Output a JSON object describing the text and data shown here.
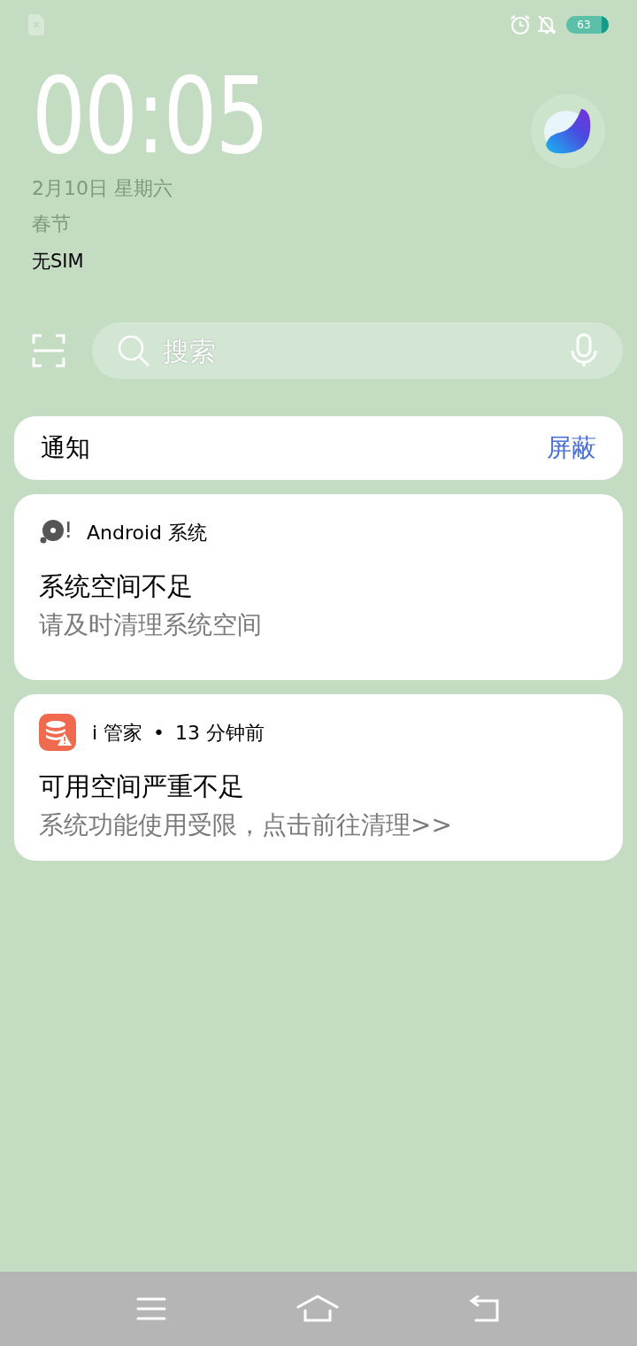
{
  "status_bar": {
    "battery_text": "63"
  },
  "clock": {
    "time": "00:05",
    "date": "2月10日 星期六",
    "holiday": "春节",
    "sim_status": "无SIM"
  },
  "search": {
    "placeholder": "搜索"
  },
  "notifications_header": {
    "title": "通知",
    "action": "屏蔽"
  },
  "notifications": [
    {
      "kind": "disk",
      "app": "Android 系统",
      "title": "系统空间不足",
      "body": "请及时清理系统空间"
    },
    {
      "kind": "storage",
      "app": "i 管家",
      "separator": "•",
      "time": "13 分钟前",
      "title": "可用空间严重不足",
      "body": "系统功能使用受限，点击前往清理>>"
    }
  ]
}
